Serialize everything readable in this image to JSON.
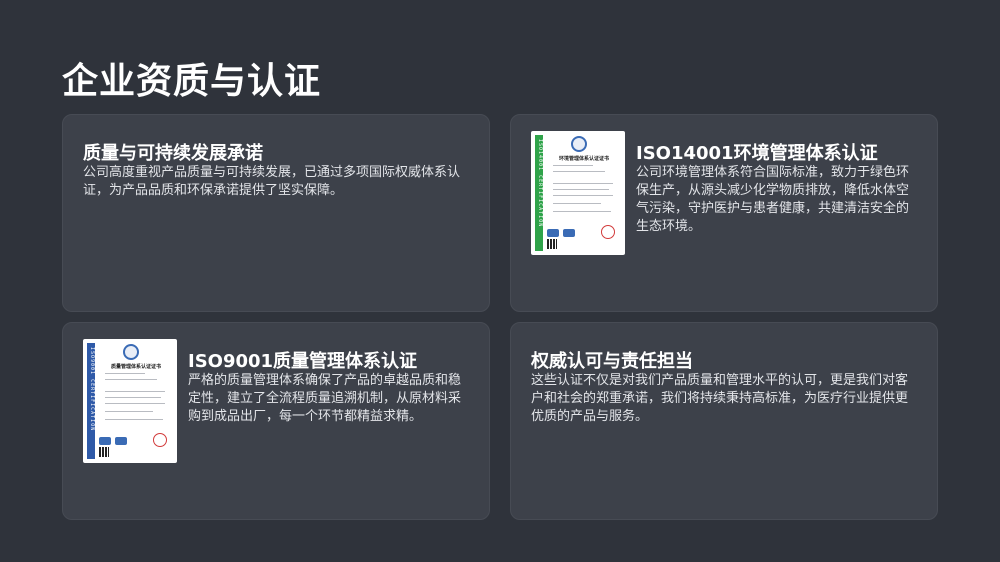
{
  "page": {
    "title": "企业资质与认证"
  },
  "cards": [
    {
      "title": "质量与可持续发展承诺",
      "description": "公司高度重视产品质量与可持续发展，已通过多项国际权威体系认证，为产品品质和环保承诺提供了坚实保障。"
    },
    {
      "title": "ISO14001环境管理体系认证",
      "description": "公司环境管理体系符合国际标准，致力于绿色环保生产，从源头减少化学物质排放，降低水体空气污染，守护医护与患者健康，共建清洁安全的生态环境。",
      "certificate": {
        "band_text": "ISO14001   CERTIFICATION",
        "heading": "环境管理体系认证证书",
        "band_color": "#2fa34a"
      }
    },
    {
      "title": "ISO9001质量管理体系认证",
      "description": "严格的质量管理体系确保了产品的卓越品质和稳定性，建立了全流程质量追溯机制，从原材料采购到成品出厂，每一个环节都精益求精。",
      "certificate": {
        "band_text": "ISO9001   CERTIFICATION",
        "heading": "质量管理体系认证证书",
        "band_color": "#2f5aa8"
      }
    },
    {
      "title": "权威认可与责任担当",
      "description": "这些认证不仅是对我们产品质量和管理水平的认可，更是我们对客户和社会的郑重承诺，我们将持续秉持高标准，为医疗行业提供更优质的产品与服务。"
    }
  ]
}
